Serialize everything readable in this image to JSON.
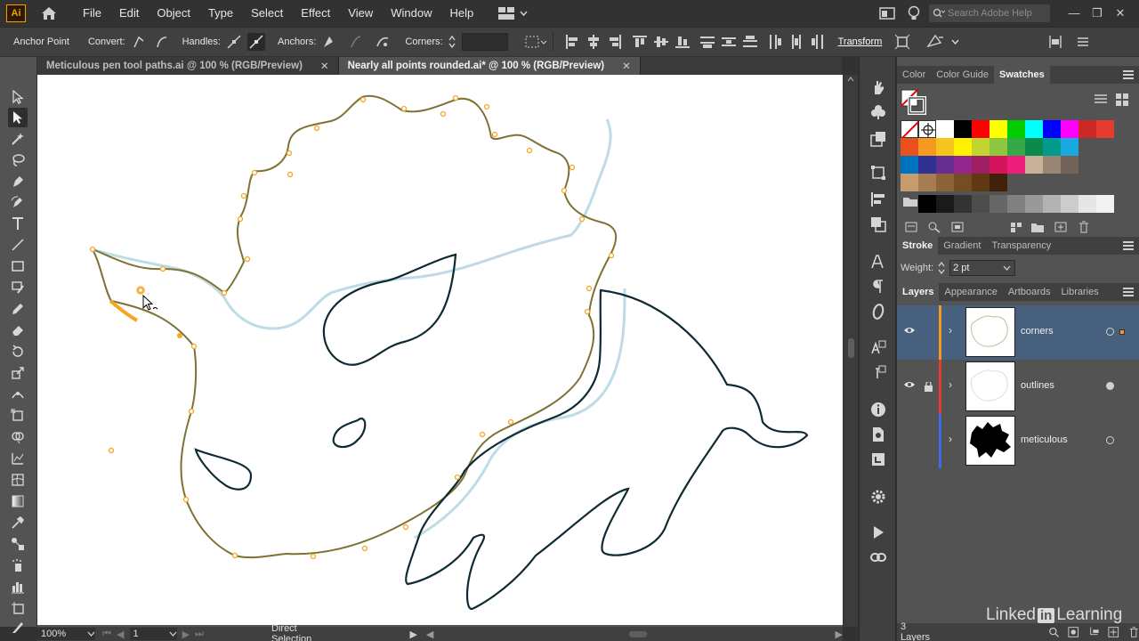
{
  "app": {
    "logo_text": "Ai"
  },
  "menu": {
    "items": [
      "File",
      "Edit",
      "Object",
      "Type",
      "Select",
      "Effect",
      "View",
      "Window",
      "Help"
    ],
    "search_placeholder": "Search Adobe Help"
  },
  "control_bar": {
    "tool_name": "Anchor Point",
    "convert_label": "Convert:",
    "handles_label": "Handles:",
    "anchors_label": "Anchors:",
    "corners_label": "Corners:",
    "transform_label": "Transform"
  },
  "tabs": [
    {
      "label": "Meticulous pen tool paths.ai @ 100 % (RGB/Preview)",
      "close": "✕",
      "active": false
    },
    {
      "label": "Nearly all points rounded.ai* @ 100 % (RGB/Preview)",
      "close": "✕",
      "active": true
    }
  ],
  "status": {
    "zoom": "100%",
    "artboard": "1",
    "tool": "Direct Selection"
  },
  "color_panel": {
    "tabs": [
      "Color",
      "Color Guide",
      "Swatches"
    ],
    "active_tab": "Swatches",
    "swatch_rows": [
      [
        "#ffffff",
        "#000000",
        "#ff0000",
        "#ffff00",
        "#00cc00",
        "#00ffff",
        "#0000ff",
        "#ff00ff",
        "#cc2828",
        "#e63b2e"
      ],
      [
        "#e8501e",
        "#f59a1e",
        "#f5c51e",
        "#fff200",
        "#c2d52d",
        "#8ec63f",
        "#35a84a",
        "#0b8a4e",
        "#009b8a",
        "#1aa8e0"
      ],
      [
        "#0071bc",
        "#2e3192",
        "#662d91",
        "#93278f",
        "#9e1f63",
        "#d4145a",
        "#ed1e79",
        "#c7b299",
        "#998675",
        "#736357"
      ],
      [
        "#c69c6d",
        "#a67c52",
        "#8c6239",
        "#754c24",
        "#603813",
        "#42210b"
      ],
      [
        "#000000",
        "#1a1a1a",
        "#333333",
        "#4d4d4d",
        "#666666",
        "#808080",
        "#999999",
        "#b3b3b3",
        "#cccccc",
        "#e6e6e6",
        "#f2f2f2"
      ]
    ]
  },
  "stroke_panel": {
    "tabs": [
      "Stroke",
      "Gradient",
      "Transparency"
    ],
    "active_tab": "Stroke",
    "weight_label": "Weight:",
    "weight_value": "2 pt"
  },
  "layers_panel": {
    "tabs": [
      "Layers",
      "Appearance",
      "Artboards",
      "Libraries"
    ],
    "active_tab": "Layers",
    "layers": [
      {
        "name": "corners",
        "color": "#f59a1e",
        "visible": true,
        "locked": false,
        "selected": true
      },
      {
        "name": "outlines",
        "color": "#e63b2e",
        "visible": true,
        "locked": true,
        "selected": false
      },
      {
        "name": "meticulous",
        "color": "#3b6ee6",
        "visible": false,
        "locked": false,
        "selected": false
      }
    ],
    "footer_count": "3 Layers"
  },
  "watermark": {
    "prefix": "Linked",
    "box": "in",
    "suffix": "Learning"
  }
}
